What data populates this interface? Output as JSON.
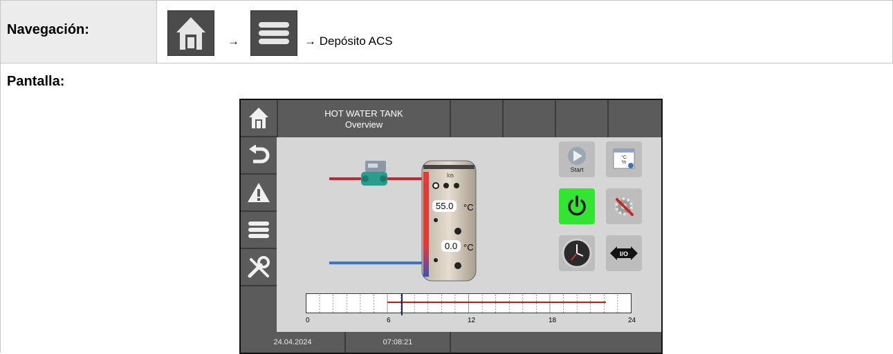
{
  "doc": {
    "nav_label": "Navegación:",
    "breadcrumb_arrow": "→",
    "breadcrumb_target": "→ Depósito ACS",
    "screen_label": "Pantalla:"
  },
  "device": {
    "title": "HOT WATER TANK",
    "subtitle": "Overview",
    "top_temp": "55.0",
    "bottom_temp": "0.0",
    "unit": "°C",
    "start_label": "Start",
    "io_label": "I/O",
    "date": "24.04.2024",
    "time": "07:08:21",
    "timeline_ticks": [
      "0",
      "6",
      "12",
      "18",
      "24"
    ]
  },
  "colors": {
    "bar_gray": "#5b5b5b",
    "screen_bg": "#d6d6d6",
    "power_green": "#33e533",
    "hot_pipe": "#c62828",
    "cold_pipe": "#3f6fd0",
    "timeline_red": "#b71c1c",
    "timeline_marker": "#1a237e"
  },
  "icons": [
    "home-icon",
    "menu-icon",
    "back-icon",
    "warning-icon",
    "tools-icon",
    "start-icon",
    "display-settings-icon",
    "power-icon",
    "settings-icon",
    "clock-icon",
    "io-icon",
    "pump-icon"
  ]
}
